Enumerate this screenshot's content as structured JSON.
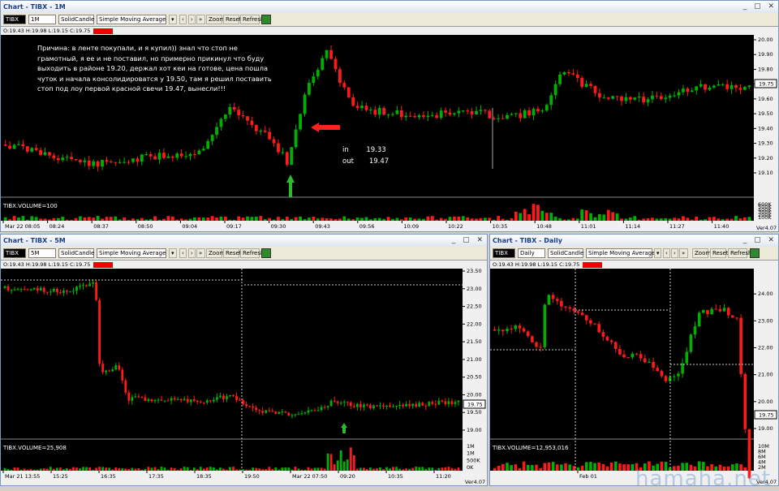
{
  "windows": [
    {
      "title": "Chart - TIBX - 1M",
      "symbol": "TIBX",
      "interval": "1M",
      "style": "SolidCandle",
      "indicator": "Simple Moving Average",
      "buttons": [
        "Zoom",
        "Reset",
        "Refresh"
      ],
      "ohlc": "O:19.43  H:19.98  L:19.15  C:19.75",
      "volume_label": "TIBX.VOLUME=100",
      "price_label": "19.75",
      "yticks": [
        "20.00",
        "19.90",
        "19.80",
        "19.70",
        "19.60",
        "19.50",
        "19.40",
        "19.30",
        "19.20",
        "19.10"
      ],
      "vol_ticks": [
        "600K",
        "500K",
        "400K",
        "300K",
        "200K",
        "100K"
      ],
      "xticks": [
        "Mar 22 08:05",
        "08:24",
        "08:37",
        "08:50",
        "09:04",
        "09:17",
        "09:30",
        "09:43",
        "09:56",
        "10:09",
        "10:22",
        "10:35",
        "10:48",
        "11:01",
        "11:14",
        "11:27",
        "11:40"
      ],
      "version": "Ver4.07"
    },
    {
      "title": "Chart - TIBX - 5M",
      "symbol": "TIBX",
      "interval": "5M",
      "style": "SolidCandle",
      "indicator": "Simple Moving Average",
      "buttons": [
        "Zoom",
        "Reset",
        "Refresh"
      ],
      "ohlc": "O:19.43  H:19.98  L:19.15  C:19.75",
      "volume_label": "TIBX.VOLUME=25,908",
      "price_label": "19.75",
      "yticks": [
        "23.50",
        "23.00",
        "22.50",
        "22.00",
        "21.50",
        "21.00",
        "20.50",
        "20.00",
        "19.50",
        "19.00"
      ],
      "vol_ticks": [
        "1M",
        "1M",
        "500K",
        "0K"
      ],
      "xticks": [
        "Mar 21 13:55",
        "15:25",
        "16:35",
        "17:35",
        "18:35",
        "19:50",
        "Mar 22 07:50",
        "09:20",
        "10:35",
        "11:20"
      ],
      "version": "Ver4.07"
    },
    {
      "title": "Chart - TIBX - Daily",
      "symbol": "TIBX",
      "interval": "Daily",
      "style": "SolidCandle",
      "indicator": "Simple Moving Average",
      "buttons": [
        "Zoom",
        "Reset",
        "Refresh"
      ],
      "ohlc": "O:19.43  H:19.98  L:19.15  C:19.75",
      "volume_label": "TIBX.VOLUME=12,953,016",
      "price_label": "19.75",
      "yticks": [
        "25.00",
        "24.00",
        "23.00",
        "22.00",
        "21.00",
        "20.00",
        "19.00"
      ],
      "vol_ticks": [
        "10M",
        "8M",
        "6M",
        "4M",
        "2M"
      ],
      "xticks": [
        "Feb 01"
      ],
      "version": "Ver4.07"
    }
  ],
  "annotation": "Причина:  в ленте покупали, и я купил))   знал что стоп не грамотный, я ее и не поставил, но примерно прикинул что буду выходить в районе 19.20, держал хот кеи на готове, цена пошла чуток и начала консолидироватся у 19.50,  там я решил поставить стоп под лоу первой красной свечи 19.47,  вынесли!!!",
  "trade_in": "in        19.33",
  "trade_out": "out       19.47",
  "watermark": "hamaha.net",
  "colors": {
    "up": "#00b000",
    "down": "#ff1a1a",
    "bg": "#000000",
    "axis": "#f0f0f0"
  }
}
